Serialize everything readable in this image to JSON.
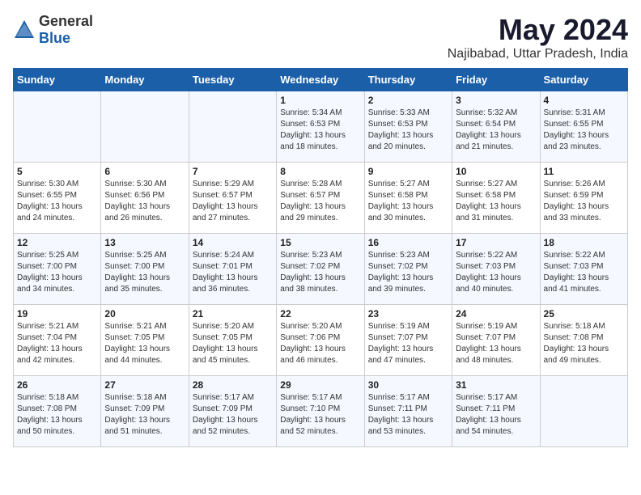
{
  "logo": {
    "text_general": "General",
    "text_blue": "Blue"
  },
  "title": "May 2024",
  "subtitle": "Najibabad, Uttar Pradesh, India",
  "days_of_week": [
    "Sunday",
    "Monday",
    "Tuesday",
    "Wednesday",
    "Thursday",
    "Friday",
    "Saturday"
  ],
  "weeks": [
    [
      {
        "day": "",
        "content": ""
      },
      {
        "day": "",
        "content": ""
      },
      {
        "day": "",
        "content": ""
      },
      {
        "day": "1",
        "content": "Sunrise: 5:34 AM\nSunset: 6:53 PM\nDaylight: 13 hours\nand 18 minutes."
      },
      {
        "day": "2",
        "content": "Sunrise: 5:33 AM\nSunset: 6:53 PM\nDaylight: 13 hours\nand 20 minutes."
      },
      {
        "day": "3",
        "content": "Sunrise: 5:32 AM\nSunset: 6:54 PM\nDaylight: 13 hours\nand 21 minutes."
      },
      {
        "day": "4",
        "content": "Sunrise: 5:31 AM\nSunset: 6:55 PM\nDaylight: 13 hours\nand 23 minutes."
      }
    ],
    [
      {
        "day": "5",
        "content": "Sunrise: 5:30 AM\nSunset: 6:55 PM\nDaylight: 13 hours\nand 24 minutes."
      },
      {
        "day": "6",
        "content": "Sunrise: 5:30 AM\nSunset: 6:56 PM\nDaylight: 13 hours\nand 26 minutes."
      },
      {
        "day": "7",
        "content": "Sunrise: 5:29 AM\nSunset: 6:57 PM\nDaylight: 13 hours\nand 27 minutes."
      },
      {
        "day": "8",
        "content": "Sunrise: 5:28 AM\nSunset: 6:57 PM\nDaylight: 13 hours\nand 29 minutes."
      },
      {
        "day": "9",
        "content": "Sunrise: 5:27 AM\nSunset: 6:58 PM\nDaylight: 13 hours\nand 30 minutes."
      },
      {
        "day": "10",
        "content": "Sunrise: 5:27 AM\nSunset: 6:58 PM\nDaylight: 13 hours\nand 31 minutes."
      },
      {
        "day": "11",
        "content": "Sunrise: 5:26 AM\nSunset: 6:59 PM\nDaylight: 13 hours\nand 33 minutes."
      }
    ],
    [
      {
        "day": "12",
        "content": "Sunrise: 5:25 AM\nSunset: 7:00 PM\nDaylight: 13 hours\nand 34 minutes."
      },
      {
        "day": "13",
        "content": "Sunrise: 5:25 AM\nSunset: 7:00 PM\nDaylight: 13 hours\nand 35 minutes."
      },
      {
        "day": "14",
        "content": "Sunrise: 5:24 AM\nSunset: 7:01 PM\nDaylight: 13 hours\nand 36 minutes."
      },
      {
        "day": "15",
        "content": "Sunrise: 5:23 AM\nSunset: 7:02 PM\nDaylight: 13 hours\nand 38 minutes."
      },
      {
        "day": "16",
        "content": "Sunrise: 5:23 AM\nSunset: 7:02 PM\nDaylight: 13 hours\nand 39 minutes."
      },
      {
        "day": "17",
        "content": "Sunrise: 5:22 AM\nSunset: 7:03 PM\nDaylight: 13 hours\nand 40 minutes."
      },
      {
        "day": "18",
        "content": "Sunrise: 5:22 AM\nSunset: 7:03 PM\nDaylight: 13 hours\nand 41 minutes."
      }
    ],
    [
      {
        "day": "19",
        "content": "Sunrise: 5:21 AM\nSunset: 7:04 PM\nDaylight: 13 hours\nand 42 minutes."
      },
      {
        "day": "20",
        "content": "Sunrise: 5:21 AM\nSunset: 7:05 PM\nDaylight: 13 hours\nand 44 minutes."
      },
      {
        "day": "21",
        "content": "Sunrise: 5:20 AM\nSunset: 7:05 PM\nDaylight: 13 hours\nand 45 minutes."
      },
      {
        "day": "22",
        "content": "Sunrise: 5:20 AM\nSunset: 7:06 PM\nDaylight: 13 hours\nand 46 minutes."
      },
      {
        "day": "23",
        "content": "Sunrise: 5:19 AM\nSunset: 7:07 PM\nDaylight: 13 hours\nand 47 minutes."
      },
      {
        "day": "24",
        "content": "Sunrise: 5:19 AM\nSunset: 7:07 PM\nDaylight: 13 hours\nand 48 minutes."
      },
      {
        "day": "25",
        "content": "Sunrise: 5:18 AM\nSunset: 7:08 PM\nDaylight: 13 hours\nand 49 minutes."
      }
    ],
    [
      {
        "day": "26",
        "content": "Sunrise: 5:18 AM\nSunset: 7:08 PM\nDaylight: 13 hours\nand 50 minutes."
      },
      {
        "day": "27",
        "content": "Sunrise: 5:18 AM\nSunset: 7:09 PM\nDaylight: 13 hours\nand 51 minutes."
      },
      {
        "day": "28",
        "content": "Sunrise: 5:17 AM\nSunset: 7:09 PM\nDaylight: 13 hours\nand 52 minutes."
      },
      {
        "day": "29",
        "content": "Sunrise: 5:17 AM\nSunset: 7:10 PM\nDaylight: 13 hours\nand 52 minutes."
      },
      {
        "day": "30",
        "content": "Sunrise: 5:17 AM\nSunset: 7:11 PM\nDaylight: 13 hours\nand 53 minutes."
      },
      {
        "day": "31",
        "content": "Sunrise: 5:17 AM\nSunset: 7:11 PM\nDaylight: 13 hours\nand 54 minutes."
      },
      {
        "day": "",
        "content": ""
      }
    ]
  ]
}
